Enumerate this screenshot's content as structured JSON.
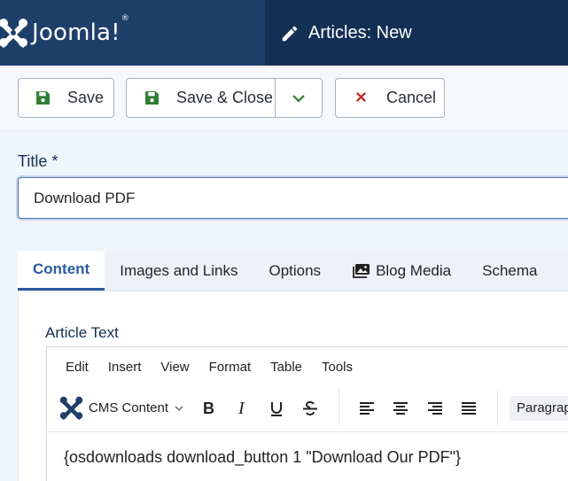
{
  "header": {
    "brand": "Joomla!",
    "page_title": "Articles: New"
  },
  "toolbar": {
    "save": "Save",
    "save_close": "Save & Close",
    "cancel": "Cancel"
  },
  "form": {
    "title_label": "Title *",
    "title_value": "Download PDF"
  },
  "tabs": [
    {
      "label": "Content"
    },
    {
      "label": "Images and Links"
    },
    {
      "label": "Options"
    },
    {
      "label": "Blog Media"
    },
    {
      "label": "Schema"
    }
  ],
  "editor": {
    "label": "Article Text",
    "menu": [
      "Edit",
      "Insert",
      "View",
      "Format",
      "Table",
      "Tools"
    ],
    "cms_content": "CMS Content",
    "block_format": "Paragraph",
    "content": "{osdownloads download_button 1 \"Download Our PDF\"}"
  },
  "colors": {
    "header_dark": "#132f53",
    "brand_bg": "#1f3f6b",
    "accent": "#2a5aa2",
    "save_icon": "#2f7d32",
    "cancel_icon": "#c52827"
  }
}
